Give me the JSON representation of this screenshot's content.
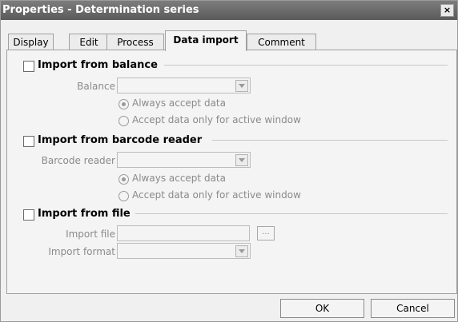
{
  "window": {
    "title": "Properties - Determination series",
    "close_glyph": "×"
  },
  "tabs": [
    {
      "label": "Display",
      "active": false
    },
    {
      "label": "Edit",
      "active": false
    },
    {
      "label": "Process",
      "active": false
    },
    {
      "label": "Data import",
      "active": true
    },
    {
      "label": "Comment",
      "active": false
    }
  ],
  "balance_section": {
    "title": "Import from balance",
    "checked": false,
    "balance_label": "Balance",
    "balance_value": "",
    "radio_always": "Always accept data",
    "radio_active": "Accept data only for active window"
  },
  "barcode_section": {
    "title": "Import from barcode reader",
    "checked": false,
    "reader_label": "Barcode reader",
    "reader_value": "",
    "radio_always": "Always accept data",
    "radio_active": "Accept data only for active window"
  },
  "file_section": {
    "title": "Import from file",
    "checked": false,
    "file_label": "Import file",
    "file_value": "",
    "browse_label": "...",
    "format_label": "Import format",
    "format_value": ""
  },
  "buttons": {
    "ok": "OK",
    "cancel": "Cancel"
  }
}
